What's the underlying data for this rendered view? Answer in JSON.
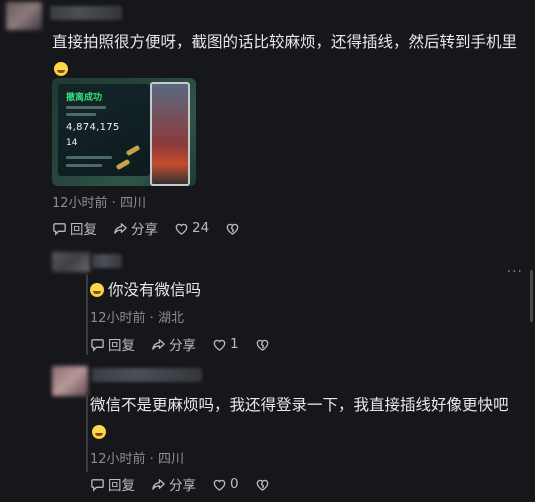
{
  "comments": [
    {
      "text": "直接拍照很方便呀，截图的话比较麻烦，还得插线，然后转到手机里",
      "meta": "12小时前 · 四川",
      "actions": {
        "reply": "回复",
        "share": "分享",
        "like_count": "24"
      },
      "image": {
        "title": "撤离成功",
        "number_main": "4,874,175",
        "number_secondary": "14"
      }
    },
    {
      "text": "你没有微信吗",
      "meta": "12小时前 · 湖北",
      "actions": {
        "reply": "回复",
        "share": "分享",
        "like_count": "1"
      }
    },
    {
      "text": "微信不是更麻烦吗，我还得登录一下，我直接插线好像更快吧",
      "meta": "12小时前 · 四川",
      "actions": {
        "reply": "回复",
        "share": "分享",
        "like_count": "0"
      }
    }
  ],
  "colors": {
    "background": "#16171b",
    "text": "#e8e8e8",
    "meta": "#8b8d93"
  }
}
